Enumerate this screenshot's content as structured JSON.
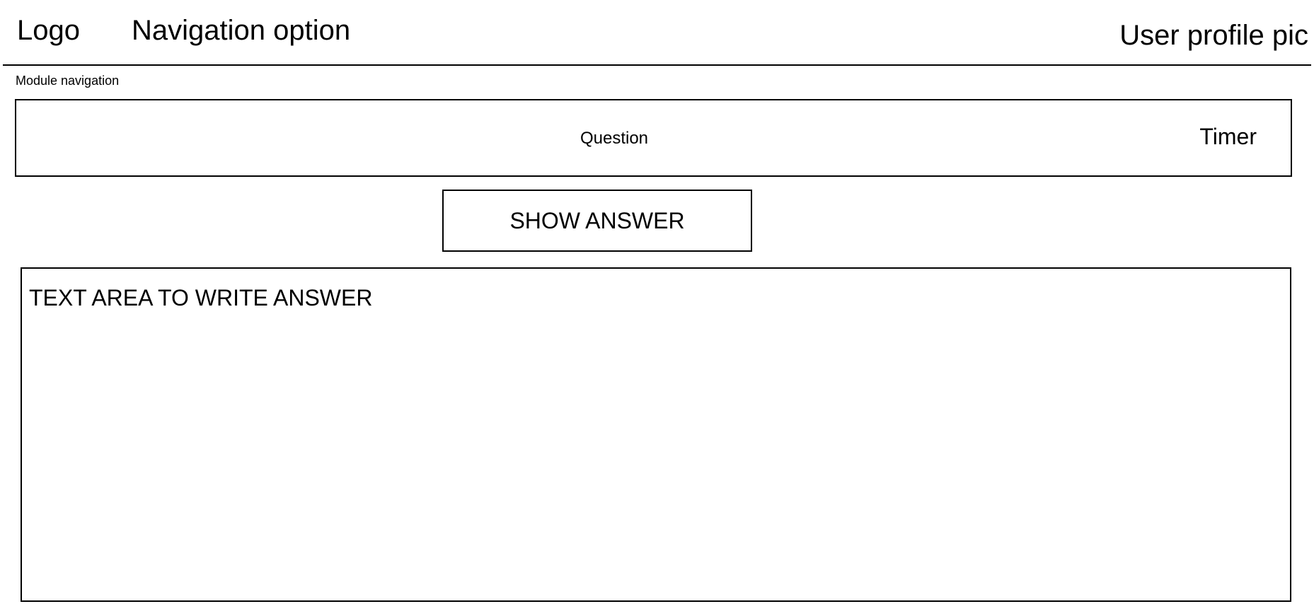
{
  "header": {
    "logo": "Logo",
    "navigation": "Navigation option",
    "profile": "User profile pic"
  },
  "module_navigation": "Module navigation",
  "question_panel": {
    "question": "Question",
    "timer": "Timer"
  },
  "show_answer": {
    "label": "SHOW ANSWER"
  },
  "answer_area": {
    "placeholder": "TEXT AREA TO WRITE ANSWER",
    "value": ""
  }
}
